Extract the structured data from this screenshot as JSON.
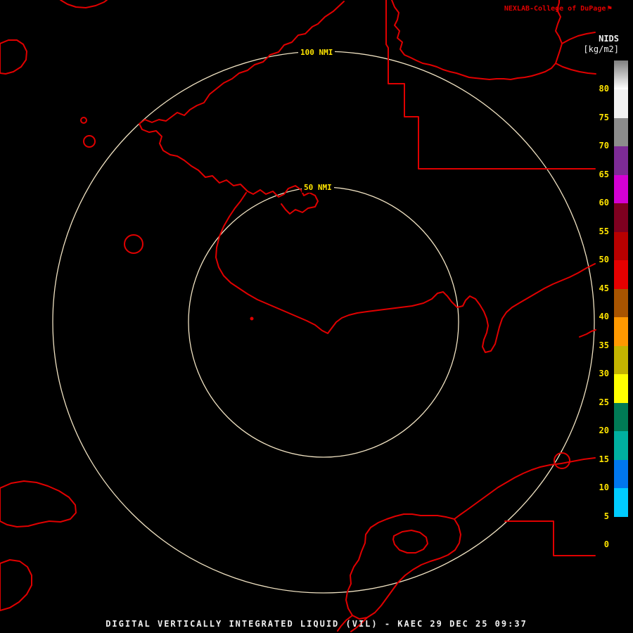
{
  "colors": {
    "map-red": "#e00000",
    "ring": "#f0e2c2",
    "label-yellow": "#ffe400",
    "text-white": "#f0f0f0",
    "background": "#000000"
  },
  "header": {
    "brand": "NEXLAB-College of DuPage",
    "brand_icon": "⚑"
  },
  "colorbar": {
    "title": "NIDS",
    "unit": "[kg/m2]",
    "ticks": [
      80,
      75,
      70,
      65,
      60,
      55,
      50,
      45,
      40,
      35,
      30,
      25,
      20,
      15,
      10,
      5,
      0
    ],
    "segments": [
      {
        "range": "80+",
        "bg": "linear-gradient(to bottom,#7f7f7f,#ffffff)"
      },
      {
        "range": "75-80",
        "bg": "#f2f2f2"
      },
      {
        "range": "70-75",
        "bg": "#8c8c8c"
      },
      {
        "range": "65-70",
        "bg": "#7d2b96"
      },
      {
        "range": "60-65",
        "bg": "#d400d4"
      },
      {
        "range": "55-60",
        "bg": "#7e0020"
      },
      {
        "range": "50-55",
        "bg": "#b80000"
      },
      {
        "range": "45-50",
        "bg": "#e60000"
      },
      {
        "range": "40-45",
        "bg": "#a85400"
      },
      {
        "range": "35-40",
        "bg": "#ff9900"
      },
      {
        "range": "30-35",
        "bg": "#c4b400"
      },
      {
        "range": "25-30",
        "bg": "#ffff00"
      },
      {
        "range": "20-25",
        "bg": "#007a55"
      },
      {
        "range": "15-20",
        "bg": "#00b0a0"
      },
      {
        "range": "10-15",
        "bg": "#0077ee"
      },
      {
        "range": "5-10",
        "bg": "#00ccff"
      },
      {
        "range": "0-5",
        "bg": "#000000"
      },
      {
        "range": "<0",
        "bg": "#000000"
      }
    ]
  },
  "range_rings": [
    {
      "label": "100 NMI",
      "radius_nmi": 100
    },
    {
      "label": "50 NMI",
      "radius_nmi": 50
    }
  ],
  "footer": {
    "caption": "DIGITAL VERTICALLY INTEGRATED LIQUID (VIL) - KAEC 29 DEC 25 09:37"
  }
}
